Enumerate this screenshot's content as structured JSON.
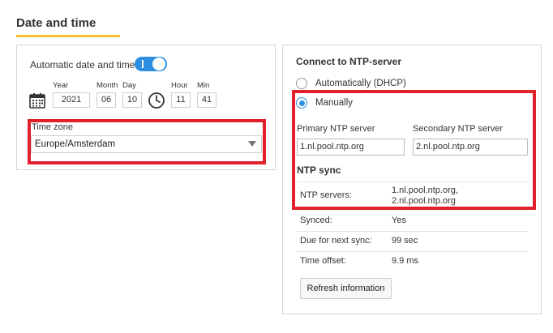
{
  "header": {
    "title": "Date and time"
  },
  "date_panel": {
    "auto_label": "Automatic date and time",
    "auto_enabled": true,
    "year_label": "Year",
    "year": "2021",
    "month_label": "Month",
    "month": "06",
    "day_label": "Day",
    "day": "10",
    "hour_label": "Hour",
    "hour": "11",
    "min_label": "Min",
    "min": "41",
    "timezone_label": "Time zone",
    "timezone_value": "Europe/Amsterdam"
  },
  "ntp_panel": {
    "title": "Connect to NTP-server",
    "option_auto": "Automatically (DHCP)",
    "option_manual": "Manually",
    "selected_option": "Manually",
    "primary_label": "Primary NTP server",
    "primary_value": "1.nl.pool.ntp.org",
    "secondary_label": "Secondary NTP server",
    "secondary_value": "2.nl.pool.ntp.org",
    "sync_title": "NTP sync",
    "rows": [
      {
        "label": "NTP servers:",
        "value_line1": "1.nl.pool.ntp.org,",
        "value_line2": "2.nl.pool.ntp.org"
      },
      {
        "label": "Synced:",
        "value": "Yes"
      },
      {
        "label": "Due for next sync:",
        "value": "99 sec"
      },
      {
        "label": "Time offset:",
        "value": "9.9 ms"
      }
    ],
    "refresh_button": "Refresh information"
  },
  "colors": {
    "accent": "#2d8fe0",
    "underline": "#f2c12e",
    "highlight": "#e0202b"
  }
}
